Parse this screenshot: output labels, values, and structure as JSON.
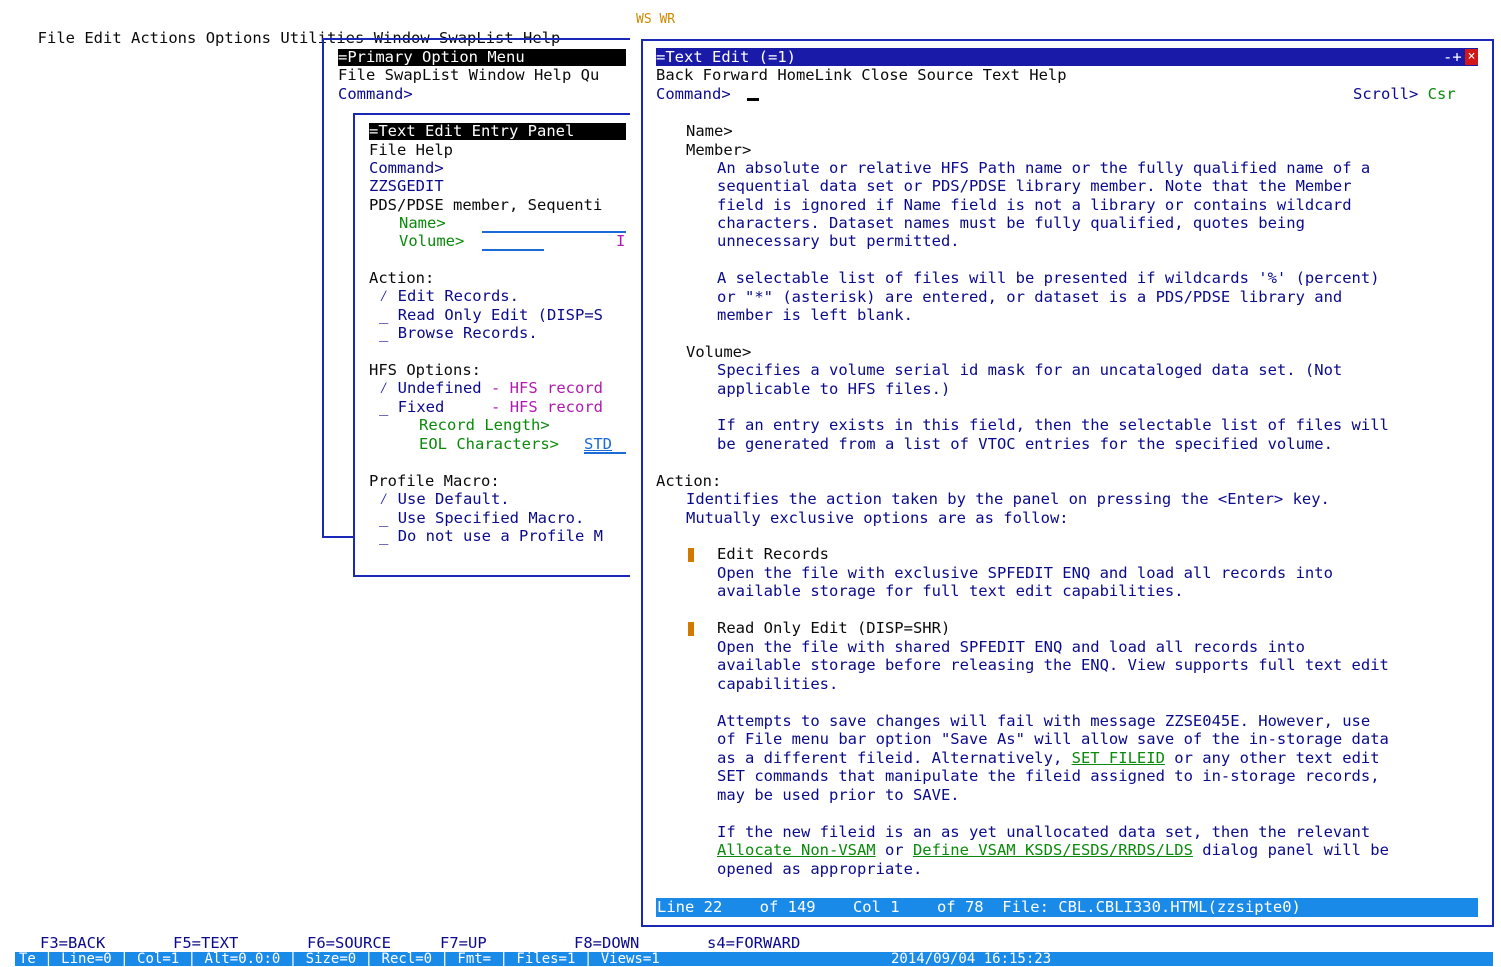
{
  "menubar": {
    "items": [
      "File",
      "Edit",
      "Actions",
      "Options",
      "Utilities",
      "Window",
      "SwapList",
      "Help"
    ],
    "indicators": [
      "WS",
      "WR"
    ]
  },
  "primary": {
    "title": "Primary Option Menu",
    "menu": "File SwapList Window Help Qu",
    "command_label": "Command>"
  },
  "entry": {
    "title": "Text Edit Entry Panel",
    "menu": "File Help",
    "command_label": "Command>",
    "panel_id": "ZZSGEDIT",
    "desc": "PDS/PDSE member, Sequenti",
    "name_label": "Name>",
    "volume_label": "Volume>",
    "volume_marker": "I",
    "action_header": "Action:",
    "actions": [
      "Edit Records.",
      "Read Only Edit (DISP=S",
      "Browse Records."
    ],
    "hfs_header": "HFS Options:",
    "hfs_undefined": "Undefined",
    "hfs_fixed": "Fixed",
    "hfs_record": "- HFS record",
    "record_length": "Record Length>",
    "eol_label": "EOL Characters>",
    "eol_value": "STD",
    "profile_header": "Profile Macro:",
    "profile": [
      "Use Default.",
      "Use Specified Macro.",
      "Do not use a Profile M"
    ],
    "check": "⁄"
  },
  "help": {
    "title": "Text Edit (=1)",
    "title_controls": "-+",
    "close_glyph": "×",
    "menu": "Back Forward HomeLink Close Source Text Help",
    "command_label": "Command>",
    "scroll_label": "Scroll>",
    "scroll_value": "Csr",
    "name_label": "Name>",
    "member_label": "Member>",
    "member_text": [
      "An absolute or relative HFS Path name or the fully qualified name of a",
      "sequential data set or PDS/PDSE library member. Note that the Member",
      "field is ignored if Name field is not a library or contains wildcard",
      "characters. Dataset names must be fully qualified, quotes being",
      "unnecessary but permitted."
    ],
    "wildcard_text": [
      "A selectable list of files will be presented if wildcards '%' (percent)",
      "or \"*\" (asterisk) are entered, or dataset is a PDS/PDSE library and",
      "member is left blank."
    ],
    "volume_label": "Volume>",
    "volume_text": [
      "Specifies a volume serial id mask for an uncataloged data set. (Not",
      "applicable to HFS files.)"
    ],
    "vtoc_text": [
      "If an entry exists in this field, then the selectable list of files will",
      "be generated from a list of VTOC entries for the specified volume."
    ],
    "action_label": "Action:",
    "action_text": [
      "Identifies the action taken by the panel on pressing the <Enter> key.",
      "Mutually exclusive options are as follow:"
    ],
    "edit_title": "Edit Records",
    "edit_text": [
      "Open the file with exclusive SPFEDIT ENQ and load all records into",
      "available storage for full text edit capabilities."
    ],
    "ro_title": "Read Only Edit (DISP=SHR)",
    "ro_text": [
      "Open the file with shared SPFEDIT ENQ and load all records into",
      "available storage before releasing the ENQ. View supports full text edit",
      "capabilities."
    ],
    "attempt_1": "Attempts to save changes will fail with message ZZSE045E. However, use",
    "attempt_2": "of File menu bar option \"Save As\" will allow save of the in-storage data",
    "attempt_3a": "as a different fileid. Alternatively, ",
    "attempt_3link": "SET FILEID",
    "attempt_3b": " or any other text edit",
    "attempt_4": "SET commands that manipulate the fileid assigned to in-storage records,",
    "attempt_5": "may be used prior to SAVE.",
    "newfile_1": "If the new fileid is an as yet unallocated data set, then the relevant",
    "newfile_link1": "Allocate Non-VSAM",
    "newfile_or": " or ",
    "newfile_link2": "Define VSAM KSDS/ESDS/RRDS/LDS",
    "newfile_2b": " dialog panel will be",
    "newfile_3": "opened as appropriate.",
    "status": "Line 22    of 149    Col 1    of 78  File: CBL.CBLI330.HTML(zzsipte0)"
  },
  "fkeys": [
    "F3=BACK",
    "F5=TEXT",
    "F6=SOURCE",
    "F7=UP",
    "F8=DOWN",
    "s4=FORWARD"
  ],
  "statusbar": {
    "items": [
      "Te",
      "Line=0",
      "Col=1",
      "Alt=0.0:0",
      "Size=0",
      "Recl=0",
      "Fmt=",
      "Files=1",
      "Views=1"
    ],
    "timestamp": "2014/09/04 16:15:23"
  }
}
